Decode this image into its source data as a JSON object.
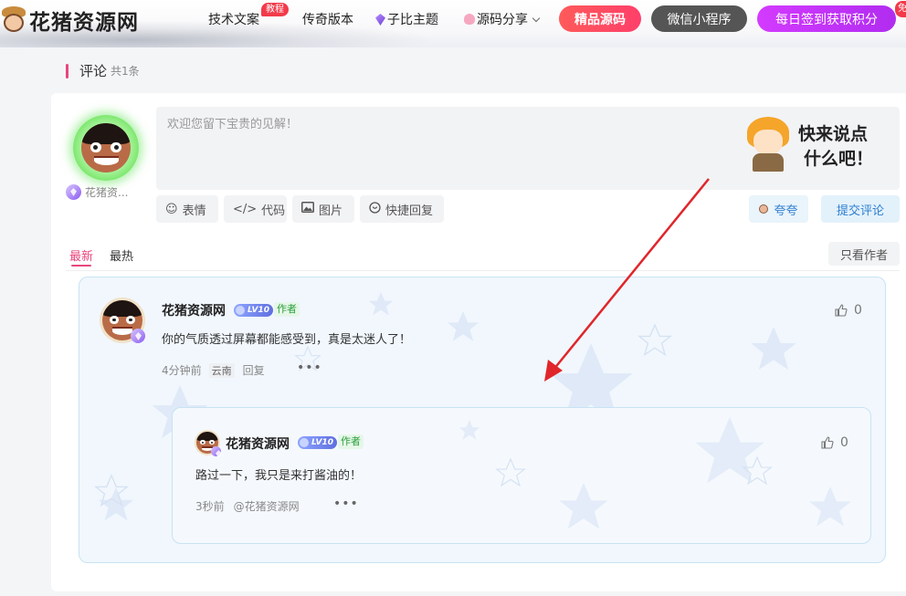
{
  "site": {
    "logo_text": "花猪资源网"
  },
  "nav": {
    "items": [
      "技术文案",
      "传奇版本",
      "子比主题",
      "源码分享"
    ],
    "badge": "教程",
    "pills": [
      "精品源码",
      "微信小程序",
      "每日签到获取积分"
    ],
    "corner_badge": "免"
  },
  "section": {
    "title": "评论",
    "count": "共1条"
  },
  "composer": {
    "placeholder": "欢迎您留下宝贵的见解！",
    "sticker_line1": "快来说点",
    "sticker_line2": "什么吧！",
    "me_name": "花猪资...",
    "tools": [
      "表情",
      "代码",
      "图片",
      "快捷回复"
    ],
    "kua_label": "夸夸",
    "submit_label": "提交评论"
  },
  "tabs": {
    "newest": "最新",
    "hottest": "最热",
    "author_only": "只看作者"
  },
  "comments": [
    {
      "name": "花猪资源网",
      "level": "LV10",
      "author_tag": "作者",
      "text": "你的气质透过屏幕都能感受到，真是太迷人了！",
      "time": "4分钟前",
      "location": "云南",
      "reply_label": "回复",
      "likes": "0",
      "replies": [
        {
          "name": "花猪资源网",
          "level": "LV10",
          "author_tag": "作者",
          "text": "路过一下，我只是来打酱油的！",
          "time": "3秒前",
          "mention": "@花猪资源网",
          "likes": "0"
        }
      ]
    }
  ],
  "colors": {
    "accent_pink": "#e8467c",
    "link_blue": "#2e7fd0",
    "author_green": "#2aa03a",
    "arrow_red": "#e0262b"
  }
}
